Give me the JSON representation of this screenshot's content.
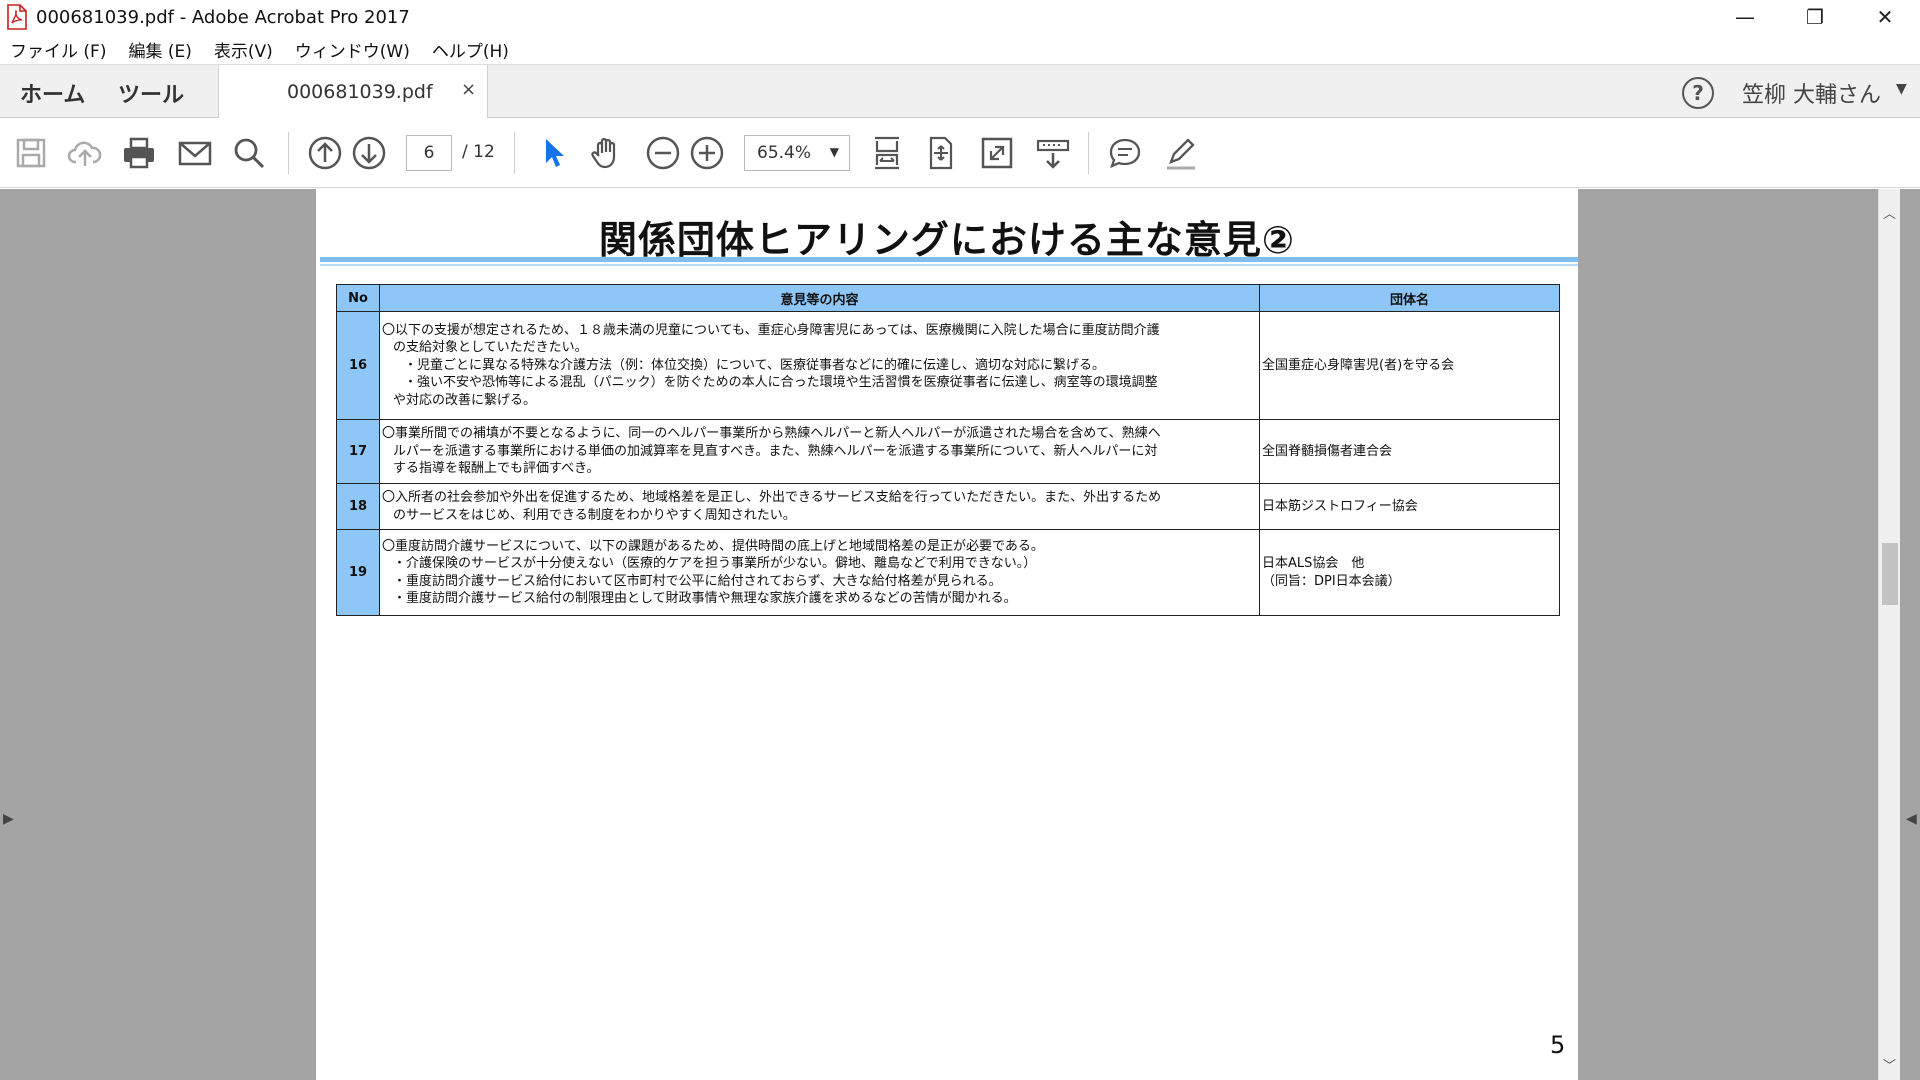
{
  "window": {
    "title": "000681039.pdf - Adobe Acrobat Pro 2017",
    "icon": "pdf-file-icon",
    "controls": {
      "minimize": "—",
      "restore": "❐",
      "close": "✕"
    }
  },
  "menu": {
    "items": [
      {
        "label": "ファイル (F)"
      },
      {
        "label": "編集 (E)"
      },
      {
        "label": "表示(V)"
      },
      {
        "label": "ウィンドウ(W)"
      },
      {
        "label": "ヘルプ(H)"
      }
    ]
  },
  "tabs": {
    "home": "ホーム",
    "tools": "ツール",
    "document": "000681039.pdf",
    "close": "×"
  },
  "account": {
    "help": "?",
    "user": "笠柳 大輔さん",
    "caret": "▼"
  },
  "toolbar": {
    "current_page": "6",
    "total_pages": "/ 12",
    "zoom": "65.4%",
    "zoom_caret": "▼"
  },
  "viewer": {
    "left_arrow": "▶",
    "right_arrow": "◀",
    "scroll_up": "︿",
    "scroll_down": "﹀"
  },
  "document": {
    "title": "関係団体ヒアリングにおける主な意見②",
    "page_number": "5",
    "table": {
      "headers": {
        "no": "No",
        "content": "意見等の内容",
        "org": "団体名"
      },
      "rows": [
        {
          "no": "16",
          "lines": [
            "〇以下の支援が想定されるため、１８歳未満の児童についても、重症心身障害児にあっては、医療機関に入院した場合に重度訪問介護",
            "の支給対象としていただきたい。",
            "・児童ごとに異なる特殊な介護方法（例：体位交換）について、医療従事者などに的確に伝達し、適切な対応に繋げる。",
            "・強い不安や恐怖等による混乱（パニック）を防ぐための本人に合った環境や生活習慣を医療従事者に伝達し、病室等の環境調整",
            "や対応の改善に繋げる。"
          ],
          "org_lines": [
            "全国重症心身障害児(者)を守る会"
          ]
        },
        {
          "no": "17",
          "lines": [
            "〇事業所間での補填が不要となるように、同一のヘルパー事業所から熟練ヘルパーと新人ヘルパーが派遣された場合を含めて、熟練ヘ",
            "ルパーを派遣する事業所における単価の加減算率を見直すべき。また、熟練ヘルパーを派遣する事業所について、新人ヘルパーに対",
            "する指導を報酬上でも評価すべき。"
          ],
          "org_lines": [
            "全国脊髄損傷者連合会"
          ]
        },
        {
          "no": "18",
          "lines": [
            "〇入所者の社会参加や外出を促進するため、地域格差を是正し、外出できるサービス支給を行っていただきたい。また、外出するため",
            "のサービスをはじめ、利用できる制度をわかりやすく周知されたい。"
          ],
          "org_lines": [
            "日本筋ジストロフィー協会"
          ]
        },
        {
          "no": "19",
          "lines": [
            "〇重度訪問介護サービスについて、以下の課題があるため、提供時間の底上げと地域間格差の是正が必要である。",
            "・介護保険のサービスが十分使えない（医療的ケアを担う事業所が少ない。僻地、離島などで利用できない。）",
            "・重度訪問介護サービス給付において区市町村で公平に給付されておらず、大きな給付格差が見られる。",
            "・重度訪問介護サービス給付の制限理由として財政事情や無理な家族介護を求めるなどの苦情が聞かれる。"
          ],
          "org_lines": [
            "日本ALS協会　他",
            "（同旨：DPI日本会議）"
          ]
        }
      ]
    }
  }
}
